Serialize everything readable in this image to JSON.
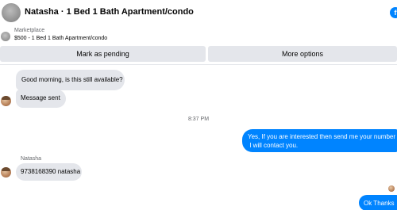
{
  "header": {
    "contact_name": "Natasha · 1 Bed 1 Bath Apartment/condo",
    "action_icon_glyph": "f",
    "accent_color": "#0084ff"
  },
  "banner": {
    "label": "Marketplace",
    "listing": "$500 - 1 Bed 1 Bath Apartment/condo"
  },
  "actions": {
    "mark_pending": "Mark as pending",
    "more_options": "More options"
  },
  "messages": {
    "m1": "Good morning, is this still available?",
    "m2": "Message sent",
    "time": "8:37 PM",
    "m3_line1": "Yes, If you are interested then send me your number",
    "m3_line2": " I will contact you.",
    "sender": "Natasha",
    "m4": "9738168390 natasha",
    "m5": "Ok Thanks"
  },
  "colors": {
    "incoming_bubble": "#e4e6eb",
    "outgoing_bubble": "#0084ff",
    "button_bg": "#e4e6eb"
  }
}
